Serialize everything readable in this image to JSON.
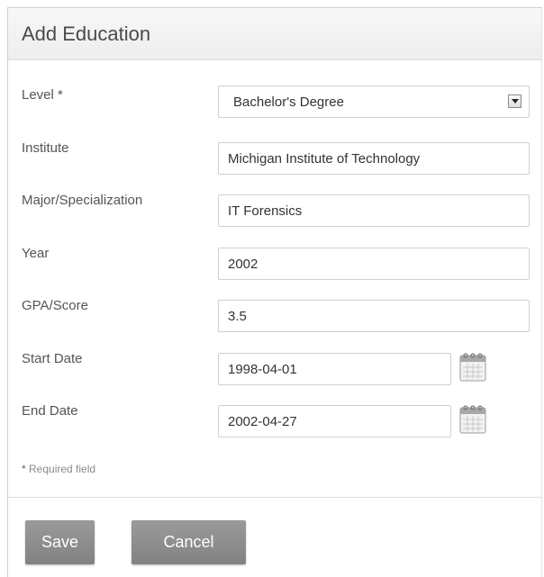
{
  "dialog": {
    "title": "Add Education"
  },
  "fields": {
    "level": {
      "label": "Level *",
      "value": "Bachelor's Degree"
    },
    "institute": {
      "label": "Institute",
      "value": "Michigan Institute of Technology"
    },
    "major": {
      "label": "Major/Specialization",
      "value": "IT Forensics"
    },
    "year": {
      "label": "Year",
      "value": "2002"
    },
    "gpa": {
      "label": "GPA/Score",
      "value": "3.5"
    },
    "start_date": {
      "label": "Start Date",
      "value": "1998-04-01"
    },
    "end_date": {
      "label": "End Date",
      "value": "2002-04-27"
    }
  },
  "required_note": {
    "star": "*",
    "text": " Required field"
  },
  "buttons": {
    "save": "Save",
    "cancel": "Cancel"
  },
  "icons": {
    "select_arrow": "chevron-down-icon",
    "date_picker": "calendar-icon"
  },
  "colors": {
    "button_bg": "#8c8c8c",
    "button_text": "#ffffff",
    "label_text": "#555555",
    "input_border": "#d0d0d0"
  }
}
